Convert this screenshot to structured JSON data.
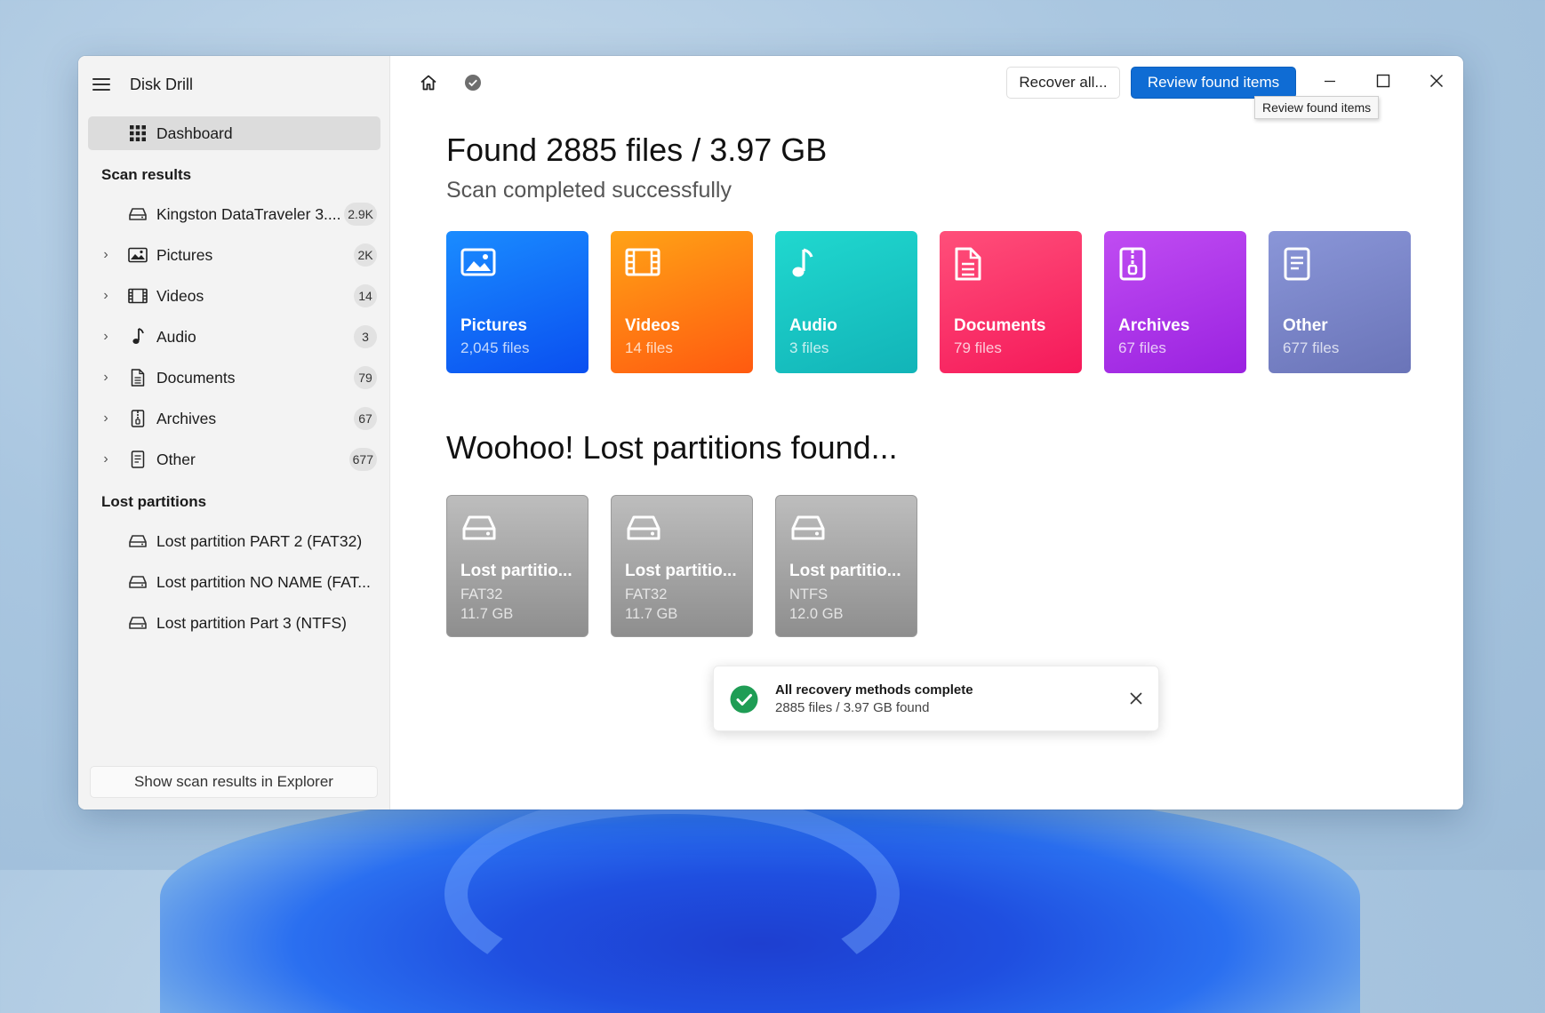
{
  "app": {
    "title": "Disk Drill"
  },
  "sidebar": {
    "dashboard_label": "Dashboard",
    "scan_results_heading": "Scan results",
    "scan_items": [
      {
        "label": "Kingston DataTraveler 3....",
        "badge": "2.9K",
        "icon": "drive-icon",
        "expandable": false
      },
      {
        "label": "Pictures",
        "badge": "2K",
        "icon": "picture-icon",
        "expandable": true
      },
      {
        "label": "Videos",
        "badge": "14",
        "icon": "film-icon",
        "expandable": true
      },
      {
        "label": "Audio",
        "badge": "3",
        "icon": "music-note-icon",
        "expandable": true
      },
      {
        "label": "Documents",
        "badge": "79",
        "icon": "document-icon",
        "expandable": true
      },
      {
        "label": "Archives",
        "badge": "67",
        "icon": "archive-icon",
        "expandable": true
      },
      {
        "label": "Other",
        "badge": "677",
        "icon": "other-file-icon",
        "expandable": true
      }
    ],
    "lost_partitions_heading": "Lost partitions",
    "lost_items": [
      {
        "label": "Lost partition PART 2 (FAT32)",
        "icon": "drive-icon"
      },
      {
        "label": "Lost partition NO NAME (FAT...",
        "icon": "drive-icon"
      },
      {
        "label": "Lost partition Part 3 (NTFS)",
        "icon": "drive-icon"
      }
    ],
    "explorer_button": "Show scan results in Explorer"
  },
  "toolbar": {
    "recover_all": "Recover all...",
    "review_found": "Review found items",
    "tooltip": "Review found items"
  },
  "main": {
    "headline": "Found 2885 files / 3.97 GB",
    "subline": "Scan completed successfully",
    "categories": [
      {
        "name": "Pictures",
        "count": "2,045 files",
        "icon": "picture-icon",
        "color_top": "#1a8cff",
        "color_bottom": "#0a4ff0"
      },
      {
        "name": "Videos",
        "count": "14 files",
        "icon": "film-icon",
        "color_top": "#ffa316",
        "color_bottom": "#ff5a10"
      },
      {
        "name": "Audio",
        "count": "3 files",
        "icon": "music-note-icon",
        "color_top": "#20d8cf",
        "color_bottom": "#12b4b8"
      },
      {
        "name": "Documents",
        "count": "79 files",
        "icon": "document-icon",
        "color_top": "#ff4f7a",
        "color_bottom": "#f5195a"
      },
      {
        "name": "Archives",
        "count": "67 files",
        "icon": "archive-icon",
        "color_top": "#c04cf2",
        "color_bottom": "#9a22e0"
      },
      {
        "name": "Other",
        "count": "677 files",
        "icon": "other-file-icon",
        "color_top": "#8a96d8",
        "color_bottom": "#6a74b8"
      }
    ],
    "partitions_headline": "Woohoo! Lost partitions found...",
    "partitions": [
      {
        "name": "Lost partitio...",
        "fs": "FAT32",
        "size": "11.7 GB"
      },
      {
        "name": "Lost partitio...",
        "fs": "FAT32",
        "size": "11.7 GB"
      },
      {
        "name": "Lost partitio...",
        "fs": "NTFS",
        "size": "12.0 GB"
      }
    ]
  },
  "toast": {
    "title": "All recovery methods complete",
    "detail": "2885 files / 3.97 GB found"
  }
}
